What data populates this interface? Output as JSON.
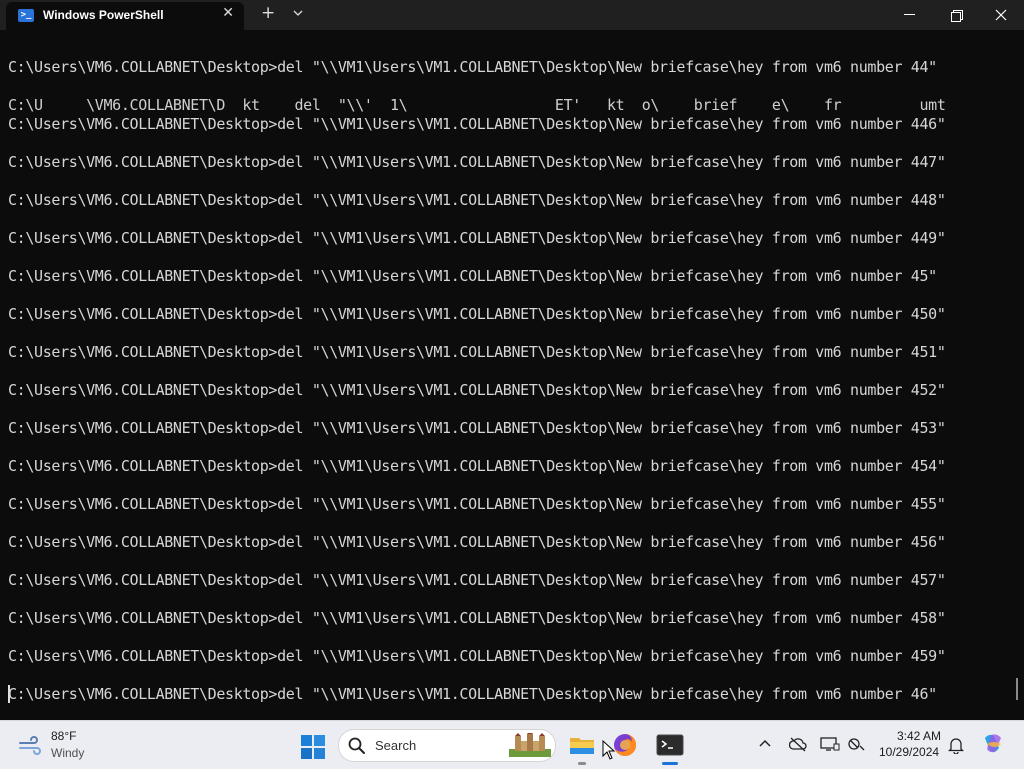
{
  "window": {
    "tab_title": "Windows PowerShell",
    "tab_icon": "powershell-icon",
    "new_tab_icon": "plus-icon",
    "dropdown_icon": "chevron-down-icon",
    "controls": [
      "minimize-icon",
      "maximize-icon",
      "close-icon"
    ]
  },
  "terminal": {
    "lines": [
      "C:\\Users\\VM6.COLLABNET\\Desktop>del \"\\\\VM1\\Users\\VM1.COLLABNET\\Desktop\\New briefcase\\hey from vm6 number 44\"",
      "C:\\U     \\VM6.COLLABNET\\D  kt    del  \"\\\\'  1\\                 ET'   kt  o\\    brief    e\\    fr         umt",
      "C:\\Users\\VM6.COLLABNET\\Desktop>del \"\\\\VM1\\Users\\VM1.COLLABNET\\Desktop\\New briefcase\\hey from vm6 number 446\"",
      "C:\\Users\\VM6.COLLABNET\\Desktop>del \"\\\\VM1\\Users\\VM1.COLLABNET\\Desktop\\New briefcase\\hey from vm6 number 447\"",
      "C:\\Users\\VM6.COLLABNET\\Desktop>del \"\\\\VM1\\Users\\VM1.COLLABNET\\Desktop\\New briefcase\\hey from vm6 number 448\"",
      "C:\\Users\\VM6.COLLABNET\\Desktop>del \"\\\\VM1\\Users\\VM1.COLLABNET\\Desktop\\New briefcase\\hey from vm6 number 449\"",
      "C:\\Users\\VM6.COLLABNET\\Desktop>del \"\\\\VM1\\Users\\VM1.COLLABNET\\Desktop\\New briefcase\\hey from vm6 number 45\"",
      "C:\\Users\\VM6.COLLABNET\\Desktop>del \"\\\\VM1\\Users\\VM1.COLLABNET\\Desktop\\New briefcase\\hey from vm6 number 450\"",
      "C:\\Users\\VM6.COLLABNET\\Desktop>del \"\\\\VM1\\Users\\VM1.COLLABNET\\Desktop\\New briefcase\\hey from vm6 number 451\"",
      "C:\\Users\\VM6.COLLABNET\\Desktop>del \"\\\\VM1\\Users\\VM1.COLLABNET\\Desktop\\New briefcase\\hey from vm6 number 452\"",
      "C:\\Users\\VM6.COLLABNET\\Desktop>del \"\\\\VM1\\Users\\VM1.COLLABNET\\Desktop\\New briefcase\\hey from vm6 number 453\"",
      "C:\\Users\\VM6.COLLABNET\\Desktop>del \"\\\\VM1\\Users\\VM1.COLLABNET\\Desktop\\New briefcase\\hey from vm6 number 454\"",
      "C:\\Users\\VM6.COLLABNET\\Desktop>del \"\\\\VM1\\Users\\VM1.COLLABNET\\Desktop\\New briefcase\\hey from vm6 number 455\"",
      "C:\\Users\\VM6.COLLABNET\\Desktop>del \"\\\\VM1\\Users\\VM1.COLLABNET\\Desktop\\New briefcase\\hey from vm6 number 456\"",
      "C:\\Users\\VM6.COLLABNET\\Desktop>del \"\\\\VM1\\Users\\VM1.COLLABNET\\Desktop\\New briefcase\\hey from vm6 number 457\"",
      "C:\\Users\\VM6.COLLABNET\\Desktop>del \"\\\\VM1\\Users\\VM1.COLLABNET\\Desktop\\New briefcase\\hey from vm6 number 458\"",
      "C:\\Users\\VM6.COLLABNET\\Desktop>del \"\\\\VM1\\Users\\VM1.COLLABNET\\Desktop\\New briefcase\\hey from vm6 number 459\"",
      "C:\\Users\\VM6.COLLABNET\\Desktop>del \"\\\\VM1\\Users\\VM1.COLLABNET\\Desktop\\New briefcase\\hey from vm6 number 46\""
    ],
    "colors": {
      "background": "#0c0c0c",
      "text": "#d6d6d6"
    }
  },
  "taskbar": {
    "weather": {
      "temp": "88°F",
      "condition": "Windy",
      "icon": "wind-icon"
    },
    "search": {
      "label": "Search",
      "icon": "search-icon"
    },
    "apps": [
      "start-icon",
      "file-explorer-icon",
      "firefox-icon",
      "terminal-icon"
    ],
    "tray_icons": [
      "chevron-up-icon",
      "onedrive-icon",
      "display-icon",
      "accessibility-icon"
    ],
    "clock": {
      "time": "3:42 AM",
      "date": "10/29/2024"
    },
    "notification_icon": "bell-icon",
    "copilot_icon": "copilot-icon"
  }
}
